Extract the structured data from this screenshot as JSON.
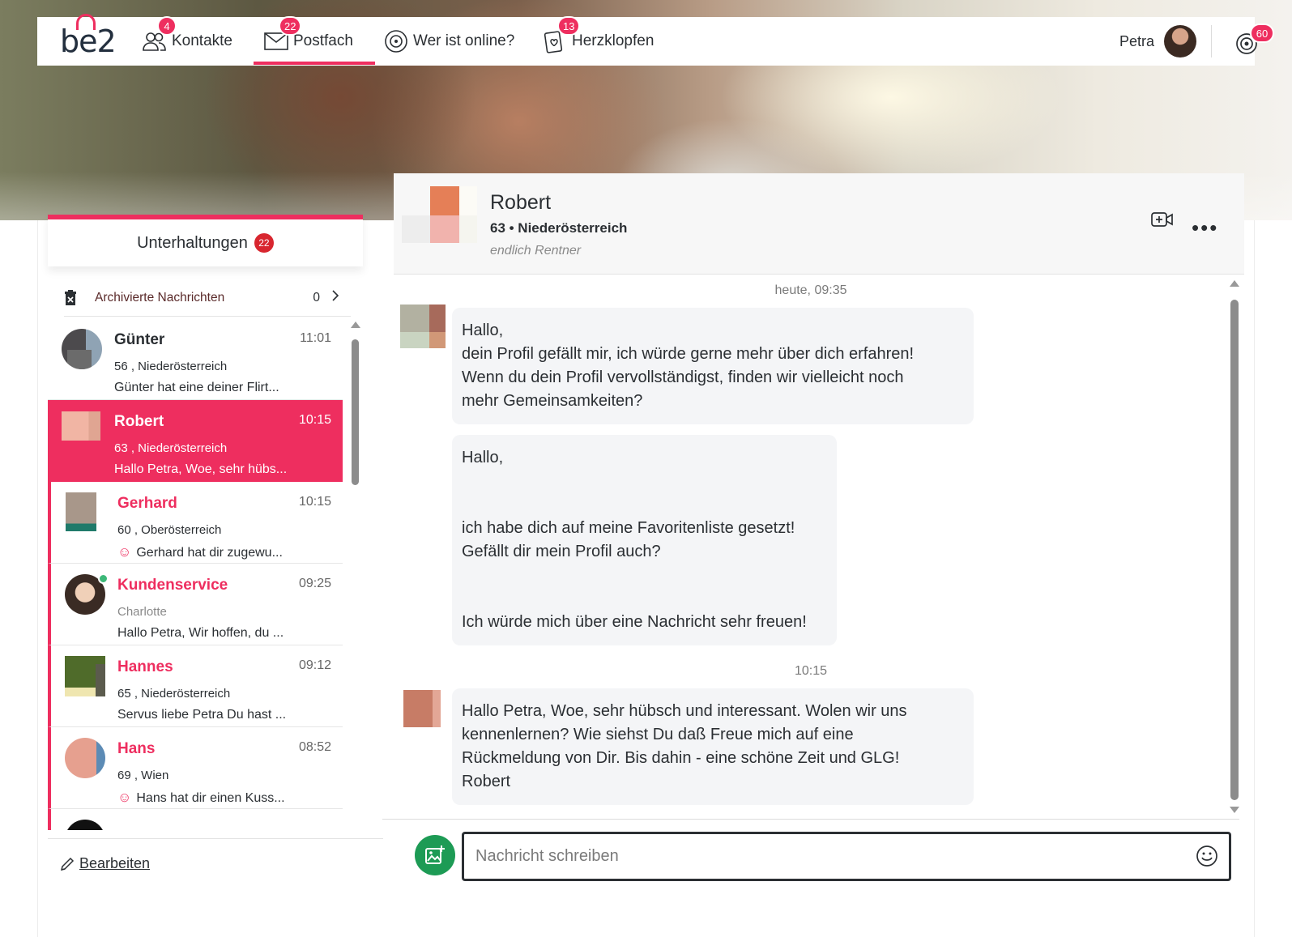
{
  "nav": {
    "logo": "be2",
    "items": [
      {
        "label": "Kontakte",
        "badge": "4",
        "icon": "contacts-icon"
      },
      {
        "label": "Postfach",
        "badge": "22",
        "icon": "mail-icon"
      },
      {
        "label": "Wer ist online?",
        "badge": "",
        "icon": "online-radar-icon"
      },
      {
        "label": "Herzklopfen",
        "badge": "13",
        "icon": "heart-cards-icon"
      }
    ],
    "user_name": "Petra",
    "coins_badge": "60"
  },
  "sidebar": {
    "title": "Unterhaltungen",
    "count": "22",
    "archive_label": "Archivierte Nachrichten",
    "archive_count": "0",
    "edit_label": "Bearbeiten",
    "conversations": [
      {
        "name": "Günter",
        "time": "11:01",
        "sub": "56 , Niederösterreich",
        "preview": "Günter hat eine deiner Flirt...",
        "state": "read"
      },
      {
        "name": "Robert",
        "time": "10:15",
        "sub": "63 , Niederösterreich",
        "preview": "Hallo Petra, Woe, sehr hübs...",
        "state": "active"
      },
      {
        "name": "Gerhard",
        "time": "10:15",
        "sub": "60 , Oberösterreich",
        "preview": "Gerhard hat dir zugewu...",
        "state": "unread"
      },
      {
        "name": "Kundenservice",
        "time": "09:25",
        "sub": "Charlotte",
        "preview": "Hallo Petra, Wir hoffen, du ...",
        "state": "unread"
      },
      {
        "name": "Hannes",
        "time": "09:12",
        "sub": "65 , Niederösterreich",
        "preview": "Servus liebe Petra Du hast ...",
        "state": "unread"
      },
      {
        "name": "Hans",
        "time": "08:52",
        "sub": "69 , Wien",
        "preview": "Hans hat dir einen Kuss...",
        "state": "unread"
      }
    ]
  },
  "chat": {
    "name": "Robert",
    "location": "63 • Niederösterreich",
    "tagline": "endlich Rentner",
    "stamp_1": "heute, 09:35",
    "stamp_2": "10:15",
    "message_1": [
      "Hallo,",
      "dein Profil gefällt mir, ich würde gerne mehr über dich erfahren!",
      "Wenn du dein Profil vervollständigst, finden wir vielleicht noch",
      "mehr Gemeinsamkeiten?"
    ],
    "message_2": [
      "Hallo,",
      "",
      "",
      "ich habe dich auf meine Favoritenliste gesetzt!",
      "Gefällt dir mein Profil auch?",
      "",
      "",
      "Ich würde mich über eine Nachricht sehr freuen!"
    ],
    "message_3": [
      "Hallo Petra, Woe, sehr hübsch und interessant. Wolen wir uns",
      "kennenlernen? Wie siehst Du daß Freue mich auf eine",
      "Rückmeldung von Dir. Bis dahin - eine schöne Zeit und GLG!",
      "Robert"
    ],
    "input_placeholder": "Nachricht schreiben"
  },
  "colors": {
    "accent": "#ee2e5f",
    "badge_dark": "#d8262f",
    "image_button": "#1d9b55",
    "online": "#3cb878"
  }
}
